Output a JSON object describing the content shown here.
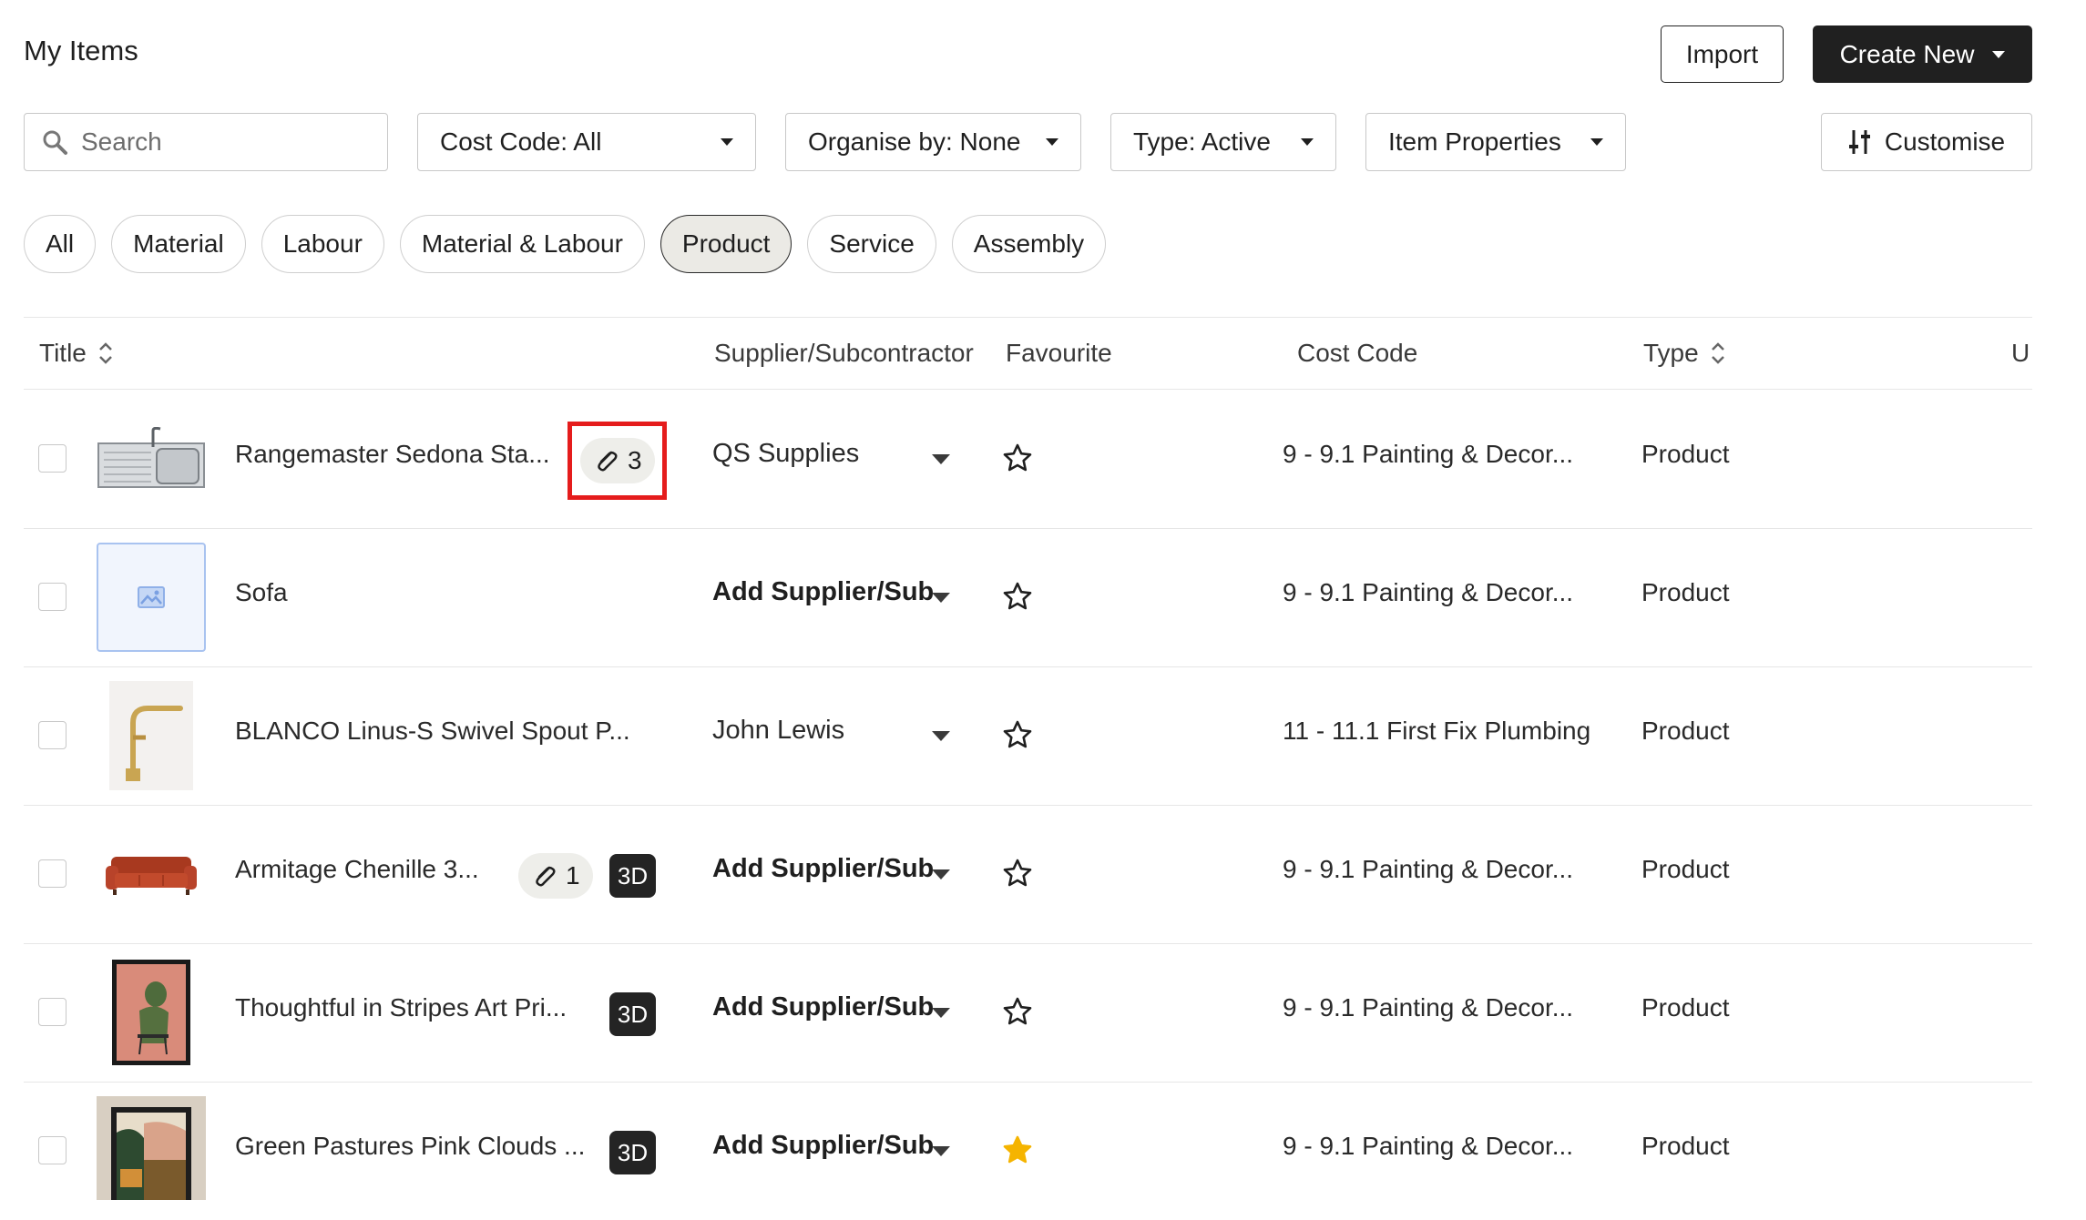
{
  "header": {
    "title": "My Items",
    "import_label": "Import",
    "create_label": "Create New"
  },
  "filters": {
    "search_placeholder": "Search",
    "cost_code": "Cost Code: All",
    "organise": "Organise by: None",
    "type": "Type: Active",
    "item_properties": "Item Properties",
    "customise": "Customise"
  },
  "category_tabs": [
    "All",
    "Material",
    "Labour",
    "Material & Labour",
    "Product",
    "Service",
    "Assembly"
  ],
  "active_tab": "Product",
  "table": {
    "columns": {
      "title": "Title",
      "supplier": "Supplier/Subcontractor",
      "favourite": "Favourite",
      "cost_code": "Cost Code",
      "type": "Type",
      "extra": "Ur"
    },
    "rows": [
      {
        "title": "Rangemaster Sedona Sta...",
        "links": "3",
        "has_3d": false,
        "supplier": "QS Supplies",
        "favourite": false,
        "cost_code": "9 - 9.1 Painting & Decor...",
        "type": "Product",
        "thumbnail": "sink-icon"
      },
      {
        "title": "Sofa",
        "links": "",
        "has_3d": false,
        "supplier": "Add Supplier/Sub",
        "favourite": false,
        "cost_code": "9 - 9.1 Painting & Decor...",
        "type": "Product",
        "thumbnail": "image-placeholder-icon"
      },
      {
        "title": "BLANCO Linus-S Swivel Spout P...",
        "links": "",
        "has_3d": false,
        "supplier": "John Lewis",
        "favourite": false,
        "cost_code": "11 - 11.1 First Fix Plumbing",
        "type": "Product",
        "thumbnail": "tap-icon"
      },
      {
        "title": "Armitage Chenille 3...",
        "links": "1",
        "has_3d": true,
        "supplier": "Add Supplier/Sub",
        "favourite": false,
        "cost_code": "9 - 9.1 Painting & Decor...",
        "type": "Product",
        "thumbnail": "sofa-icon"
      },
      {
        "title": "Thoughtful in Stripes Art Pri...",
        "links": "",
        "has_3d": true,
        "supplier": "Add Supplier/Sub",
        "favourite": false,
        "cost_code": "9 - 9.1 Painting & Decor...",
        "type": "Product",
        "thumbnail": "art-print-icon"
      },
      {
        "title": "Green Pastures Pink Clouds ...",
        "links": "",
        "has_3d": true,
        "supplier": "Add Supplier/Sub",
        "favourite": true,
        "cost_code": "9 - 9.1 Painting & Decor...",
        "type": "Product",
        "thumbnail": "art-print-icon"
      }
    ]
  },
  "labels": {
    "tag_3d": "3D"
  },
  "colors": {
    "dark_button": "#202020",
    "active_pill": "#ebeae5",
    "highlight": "#e51c1c",
    "star_filled": "#f5b400"
  }
}
